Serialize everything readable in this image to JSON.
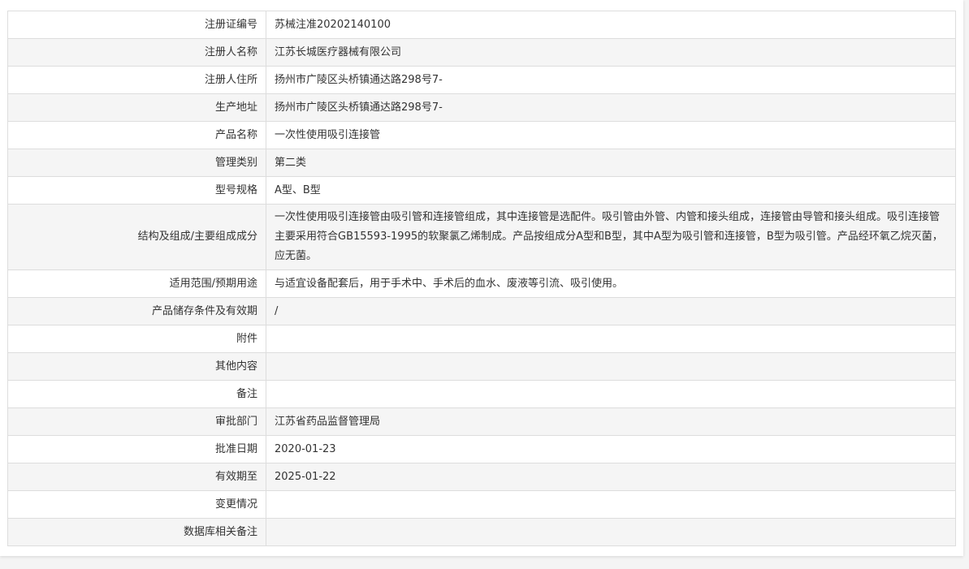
{
  "records": [
    {
      "label": "注册证编号",
      "value": "苏械注准20202140100"
    },
    {
      "label": "注册人名称",
      "value": "江苏长城医疗器械有限公司"
    },
    {
      "label": "注册人住所",
      "value": "扬州市广陵区头桥镇通达路298号7-"
    },
    {
      "label": "生产地址",
      "value": "扬州市广陵区头桥镇通达路298号7-"
    },
    {
      "label": "产品名称",
      "value": "一次性使用吸引连接管"
    },
    {
      "label": "管理类别",
      "value": "第二类"
    },
    {
      "label": "型号规格",
      "value": "A型、B型"
    },
    {
      "label": "结构及组成/主要组成成分",
      "value": "一次性使用吸引连接管由吸引管和连接管组成，其中连接管是选配件。吸引管由外管、内管和接头组成，连接管由导管和接头组成。吸引连接管主要采用符合GB15593-1995的软聚氯乙烯制成。产品按组成分A型和B型，其中A型为吸引管和连接管，B型为吸引管。产品经环氧乙烷灭菌，应无菌。"
    },
    {
      "label": "适用范围/预期用途",
      "value": "与适宜设备配套后，用于手术中、手术后的血水、废液等引流、吸引使用。"
    },
    {
      "label": "产品储存条件及有效期",
      "value": "/"
    },
    {
      "label": "附件",
      "value": ""
    },
    {
      "label": "其他内容",
      "value": ""
    },
    {
      "label": "备注",
      "value": ""
    },
    {
      "label": "审批部门",
      "value": "江苏省药品监督管理局"
    },
    {
      "label": "批准日期",
      "value": "2020-01-23"
    },
    {
      "label": "有效期至",
      "value": "2025-01-22"
    },
    {
      "label": "变更情况",
      "value": ""
    },
    {
      "label": "数据库相关备注",
      "value": ""
    }
  ]
}
